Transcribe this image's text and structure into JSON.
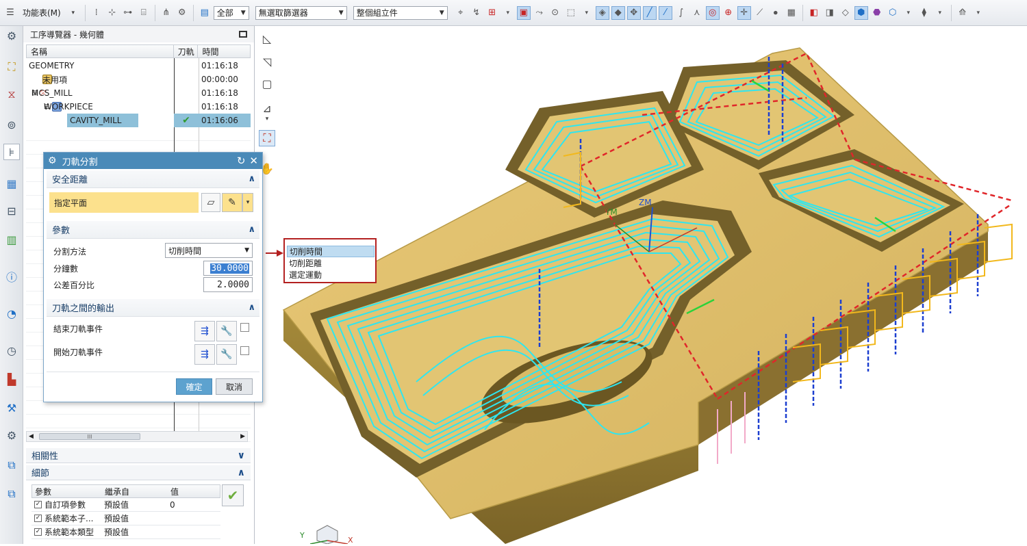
{
  "toolbar": {
    "menu_label": "功能表(M)",
    "filter_scope": "全部",
    "selection_filter": "無選取篩選器",
    "assembly_scope": "整個組立件"
  },
  "navigator": {
    "title": "工序導覽器 - 幾何體",
    "columns": [
      "名稱",
      "刀軌",
      "時間"
    ],
    "rows": [
      {
        "name": "GEOMETRY",
        "time": "01:16:18"
      },
      {
        "name": "未用項",
        "time": "00:00:00"
      },
      {
        "name": "MCS_MILL",
        "time": "01:16:18"
      },
      {
        "name": "WORKPIECE",
        "time": "01:16:18"
      },
      {
        "name": "CAVITY_MILL",
        "path_status": "✔",
        "time": "01:16:06"
      }
    ],
    "scrollbar_grip": "III"
  },
  "dependencies": {
    "label": "相關性"
  },
  "details": {
    "label": "細節",
    "columns": [
      "參數",
      "繼承自",
      "值"
    ],
    "rows": [
      {
        "param": "自訂項參數",
        "inherit": "預設值",
        "value": "0"
      },
      {
        "param": "系統範本子...",
        "inherit": "預設值",
        "value": ""
      },
      {
        "param": "系統範本類型",
        "inherit": "預設值",
        "value": ""
      }
    ]
  },
  "dialog": {
    "title": "刀軌分割",
    "safe_distance": {
      "label": "安全距離",
      "specify_plane": "指定平面"
    },
    "parameters": {
      "label": "參數",
      "split_method_label": "分割方法",
      "split_method_value": "切削時間",
      "minutes_label": "分鐘數",
      "minutes_value": "30.0000",
      "tolerance_label": "公差百分比",
      "tolerance_value": "2.0000"
    },
    "output": {
      "label": "刀軌之間的輸出",
      "end_event": "結束刀軌事件",
      "start_event": "開始刀軌事件"
    },
    "ok": "確定",
    "cancel": "取消"
  },
  "split_method_options": [
    "切削時間",
    "切削距離",
    "選定運動"
  ],
  "viewport": {
    "axis_zm": "ZM",
    "axis_ym": "YM",
    "triad_x": "X",
    "triad_y": "Y"
  },
  "colors": {
    "dialog_title": "#4a8ab8",
    "highlight": "#fce18d",
    "part_face": "#d4b35f",
    "toolpath": "#2ee6f0",
    "selection": "#8ec0d9"
  }
}
